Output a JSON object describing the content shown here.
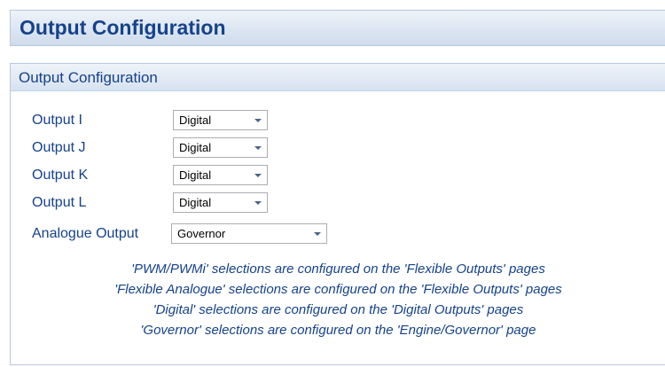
{
  "page": {
    "title": "Output Configuration"
  },
  "group": {
    "header": "Output Configuration",
    "rows": [
      {
        "label": "Output I",
        "value": "Digital"
      },
      {
        "label": "Output J",
        "value": "Digital"
      },
      {
        "label": "Output K",
        "value": "Digital"
      },
      {
        "label": "Output L",
        "value": "Digital"
      },
      {
        "label": "Analogue Output",
        "value": "Governor"
      }
    ],
    "notes": [
      "'PWM/PWMi' selections are configured on the 'Flexible Outputs' pages",
      "'Flexible Analogue' selections are configured on the 'Flexible Outputs' pages",
      "'Digital' selections are configured on the 'Digital Outputs' pages",
      "'Governor' selections are configured on the 'Engine/Governor' page"
    ]
  },
  "colors": {
    "text": "#15428b",
    "header_border": "#b7c9df",
    "header_gradient_top": "#eef3f9",
    "header_gradient_bottom": "#cfdcec"
  },
  "icons": {
    "dropdown": "chevron-down-icon"
  }
}
